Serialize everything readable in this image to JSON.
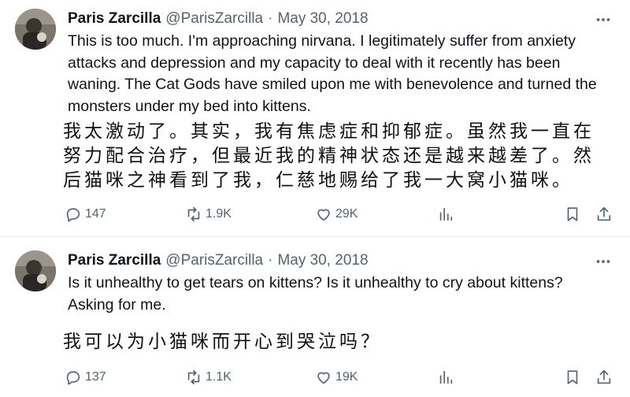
{
  "tweets": [
    {
      "author_name": "Paris Zarcilla",
      "handle": "@ParisZarcilla",
      "separator": "·",
      "date": "May 30, 2018",
      "text_en": "This is too much. I'm approaching nirvana. I legitimately suffer from anxiety attacks and depression and my capacity to deal with it recently has been waning. The Cat Gods have smiled upon me with benevolence and turned the monsters under my bed into kittens.",
      "text_zh": "我太激动了。其实，我有焦虑症和抑郁症。虽然我一直在努力配合治疗，但最近我的精神状态还是越来越差了。然后猫咪之神看到了我，仁慈地赐给了我一大窝小猫咪。",
      "replies": "147",
      "retweets": "1.9K",
      "likes": "29K"
    },
    {
      "author_name": "Paris Zarcilla",
      "handle": "@ParisZarcilla",
      "separator": "·",
      "date": "May 30, 2018",
      "text_en": "Is it unhealthy to get tears on kittens? Is it unhealthy to cry about kittens? Asking for me.",
      "text_zh": "我可以为小猫咪而开心到哭泣吗？",
      "replies": "137",
      "retweets": "1.1K",
      "likes": "19K"
    }
  ],
  "icons": {
    "more": "more-horizontal-icon",
    "reply": "reply-icon",
    "retweet": "retweet-icon",
    "like": "heart-icon",
    "views": "views-bar-chart-icon",
    "bookmark": "bookmark-icon",
    "share": "share-icon"
  },
  "colors": {
    "text": "#0f1419",
    "secondary": "#536471",
    "divider": "#e6ecf0"
  }
}
